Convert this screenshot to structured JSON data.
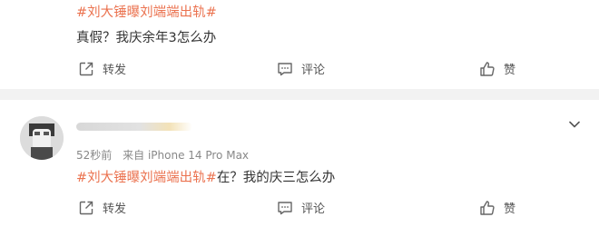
{
  "post1": {
    "hashtag": "#刘大锤曝刘端端出轨#",
    "text": "真假？我庆余年3怎么办"
  },
  "post2": {
    "time": "52秒前",
    "source_label": "来自",
    "source_device": "iPhone 14 Pro Max",
    "hashtag": "#刘大锤曝刘端端出轨#",
    "text": "在？我的庆三怎么办"
  },
  "actions": {
    "repost": "转发",
    "comment": "评论",
    "like": "赞"
  },
  "icons": {
    "repost": "share-arrow-icon",
    "comment": "comment-bubble-icon",
    "like": "thumbs-up-icon",
    "menu": "chevron-down-icon"
  },
  "colors": {
    "topic": "#eb7350",
    "separator": "#f2f2f2"
  }
}
